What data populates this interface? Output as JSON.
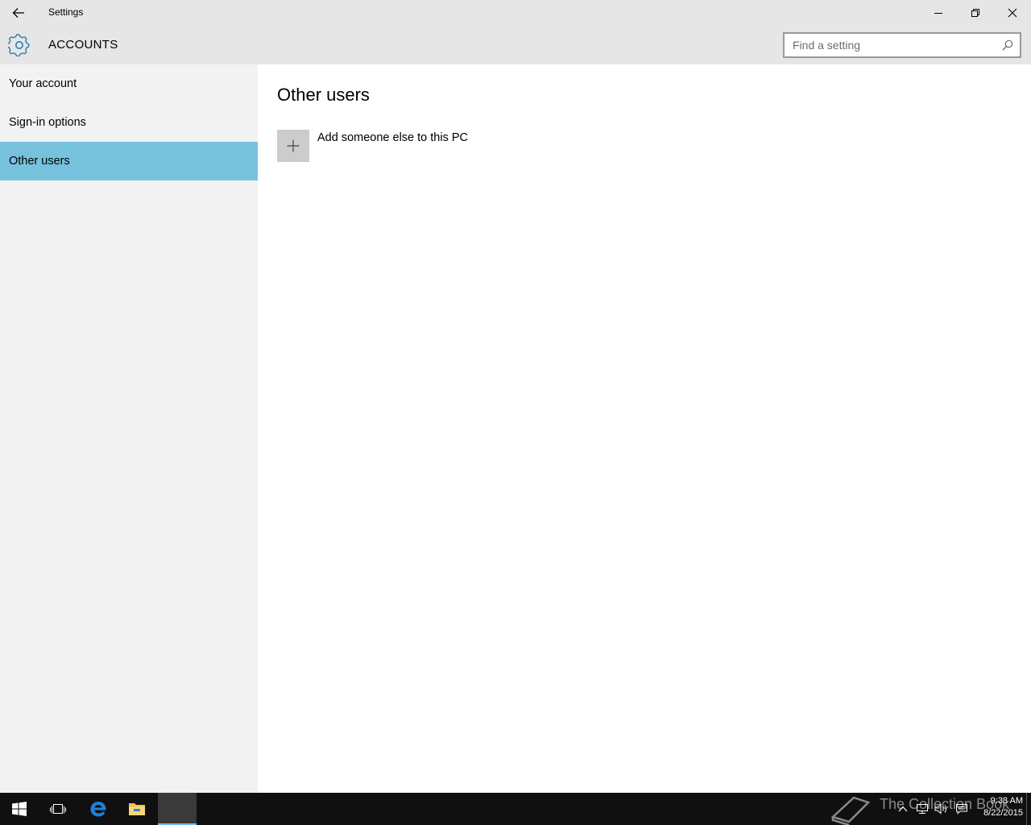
{
  "window": {
    "title": "Settings",
    "back_icon": "back-arrow-icon",
    "controls": [
      "minimize-icon",
      "restore-icon",
      "close-icon"
    ]
  },
  "header": {
    "icon": "gear-icon",
    "section_title": "ACCOUNTS",
    "accent_color": "#2d7dab"
  },
  "search": {
    "placeholder": "Find a setting",
    "value": "",
    "icon": "search-icon"
  },
  "sidebar": {
    "selected_color": "#76c2dc",
    "items": [
      {
        "label": "Your account",
        "selected": false
      },
      {
        "label": "Sign-in options",
        "selected": false
      },
      {
        "label": "Other users",
        "selected": true
      }
    ]
  },
  "main": {
    "heading": "Other users",
    "add_user": {
      "label": "Add someone else to this PC",
      "icon": "plus-icon"
    }
  },
  "taskbar": {
    "apps": [
      "windows-start-icon",
      "task-view-icon",
      "edge-icon",
      "file-explorer-icon",
      "settings-app"
    ],
    "watermark_text": "The Collection Book",
    "tray_icons": [
      "chevron-up-icon",
      "network-icon",
      "volume-icon",
      "action-center-icon"
    ],
    "clock": {
      "time": "9:33 AM",
      "date": "8/22/2015"
    }
  }
}
